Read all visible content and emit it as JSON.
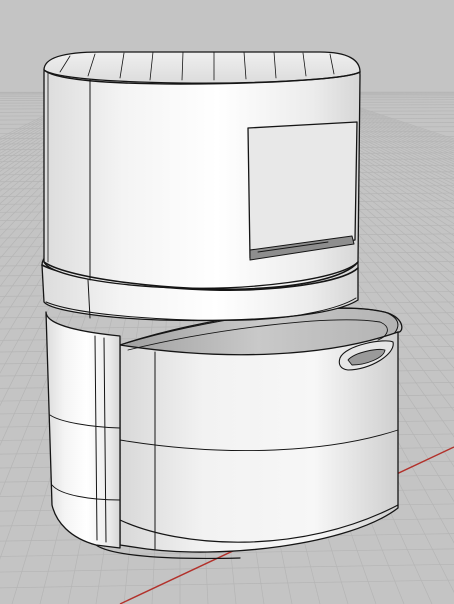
{
  "viewport": {
    "kind": "3d-perspective-viewport",
    "background_color": "#c4c4c4",
    "grid_color": "#b5b5b5",
    "x_axis_color": "#b2312b",
    "y_axis_color": "#2f7a39"
  },
  "model": {
    "name": "",
    "description_hidden": "",
    "body_color": "#e4e4e4",
    "edge_color": "#151515",
    "window_color": "#e9e9e9"
  }
}
